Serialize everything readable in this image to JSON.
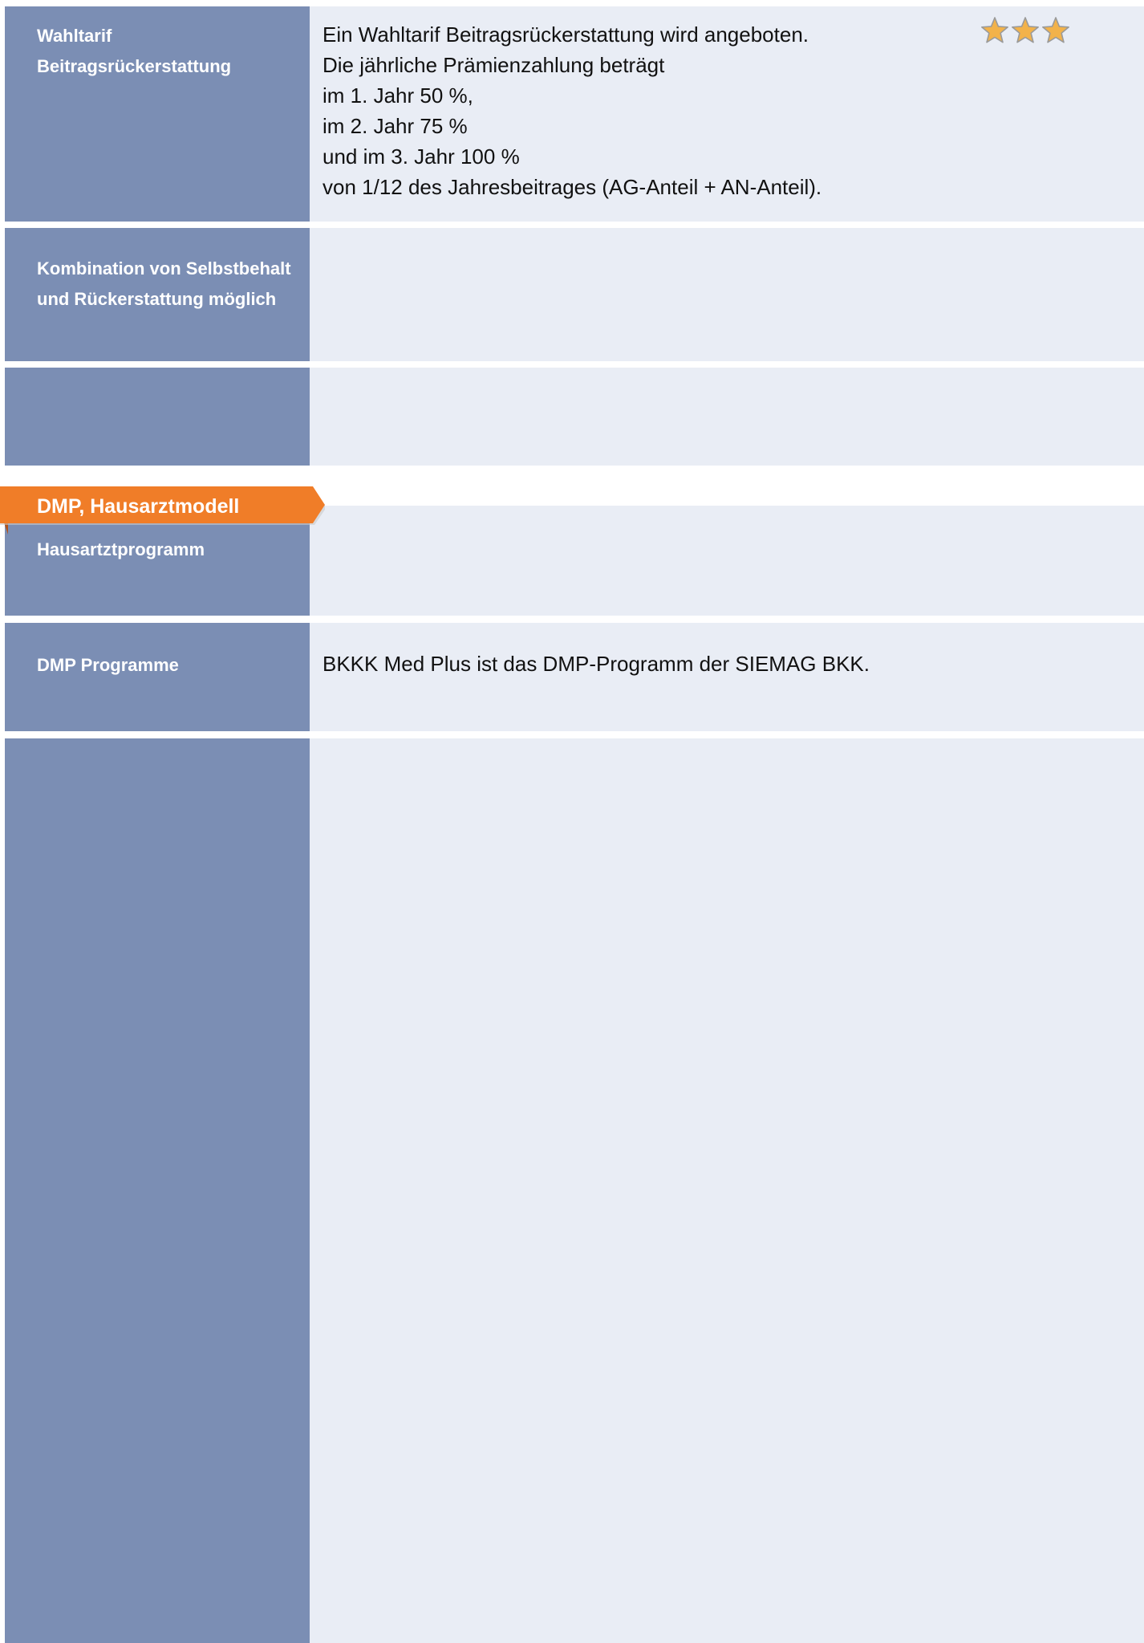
{
  "rows": [
    {
      "label": [
        "Wahltarif",
        "Beitragsrückerstattung"
      ],
      "content": [
        "Ein Wahltarif Beitragsrückerstattung wird angeboten.",
        "Die jährliche Prämienzahlung beträgt",
        "im 1. Jahr 50 %,",
        "im 2. Jahr 75 %",
        "und im 3. Jahr 100 %",
        "von 1/12 des Jahresbeitrages (AG-Anteil + AN-Anteil)."
      ],
      "rating": 3,
      "rating_max": 3
    },
    {
      "label": [
        "Kombination von Selbstbehalt",
        "und Rückerstattung möglich"
      ],
      "content": []
    },
    {
      "label": [],
      "content": []
    }
  ],
  "section": {
    "title": "DMP, Hausarztmodell",
    "color": "#f07d28"
  },
  "section_rows": [
    {
      "label": [
        "Hausartztprogramm"
      ],
      "content": []
    },
    {
      "label": [
        "DMP Programme"
      ],
      "content": [
        "BKKK Med Plus ist das DMP-Programm der SIEMAG BKK."
      ]
    },
    {
      "label": [],
      "content": []
    }
  ],
  "colors": {
    "label_bg": "#7b8eb4",
    "content_bg": "#e9edf5",
    "star_fill": "#f2b24a"
  }
}
